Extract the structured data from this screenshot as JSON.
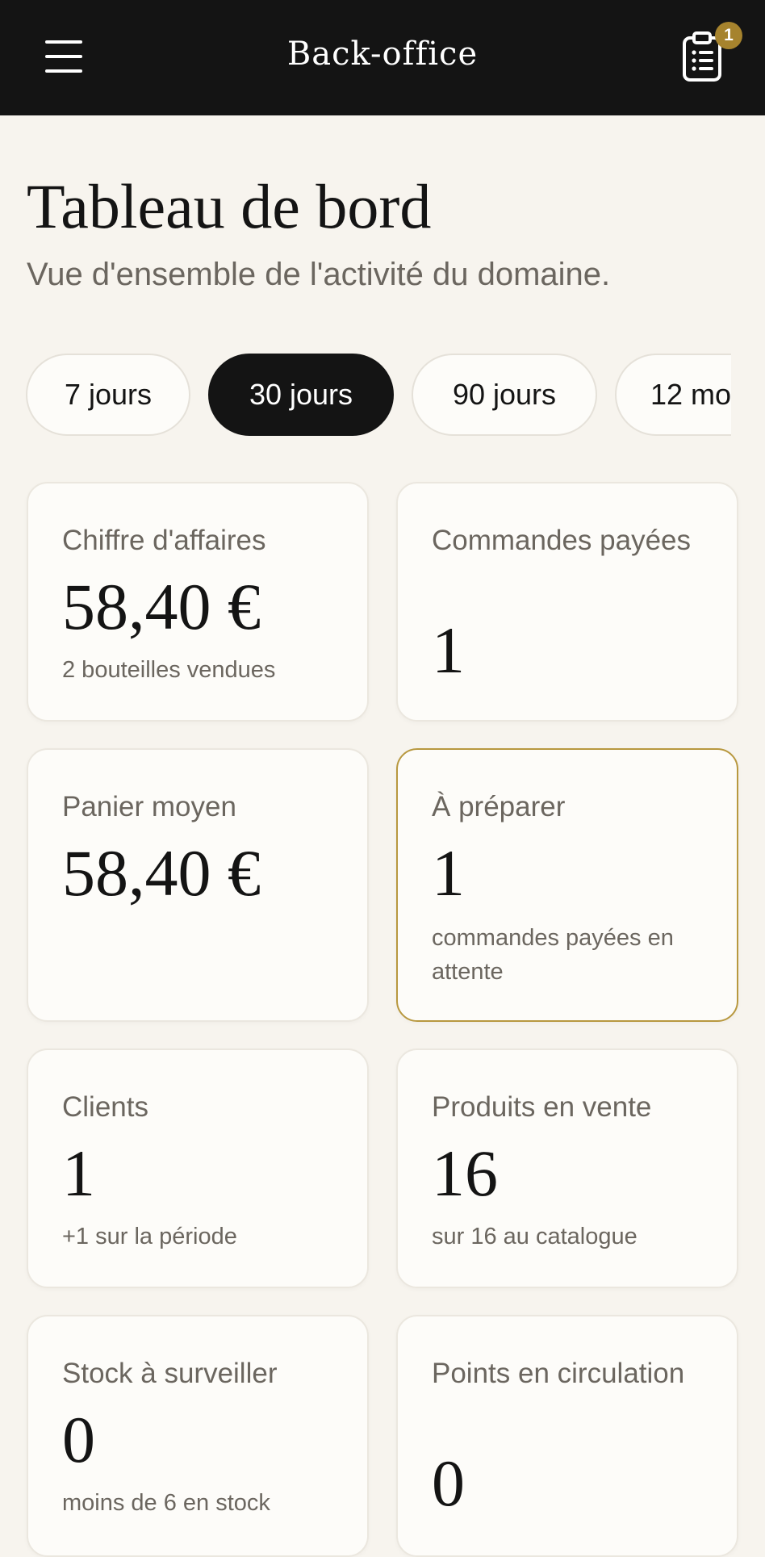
{
  "header": {
    "title": "Back-office",
    "orders_badge_count": "1",
    "menu_icon": "hamburger-icon",
    "orders_icon": "clipboard-list-icon"
  },
  "page": {
    "title": "Tableau de bord",
    "subtitle": "Vue d'ensemble de l'activité du domaine."
  },
  "filters": {
    "selected": "30 jours",
    "options": [
      "7 jours",
      "30 jours",
      "90 jours",
      "12 mo"
    ]
  },
  "cards": [
    {
      "label": "Chiffre d'affaires",
      "value": "58,40 €",
      "note": "2 bouteilles vendues"
    },
    {
      "label": "Commandes payées",
      "value": "1",
      "note": ""
    },
    {
      "label": "Panier moyen",
      "value": "58,40 €",
      "note": ""
    },
    {
      "label": "À préparer",
      "value": "1",
      "note": "commandes payées en attente"
    },
    {
      "label": "Clients",
      "value": "1",
      "note": "+1 sur la période"
    },
    {
      "label": "Produits en vente",
      "value": "16",
      "note": "sur 16 au catalogue"
    },
    {
      "label": "Stock à surveiller",
      "value": "0",
      "note": "moins de 6 en stock"
    },
    {
      "label": "Points en circulation",
      "value": "0",
      "note": ""
    }
  ],
  "colors": {
    "header_bg": "#141414",
    "page_bg": "#f7f4ee",
    "card_bg": "#fdfcf9",
    "accent_gold": "#a6832d",
    "highlight_border": "#b8983f",
    "muted_text": "#6b665f"
  }
}
